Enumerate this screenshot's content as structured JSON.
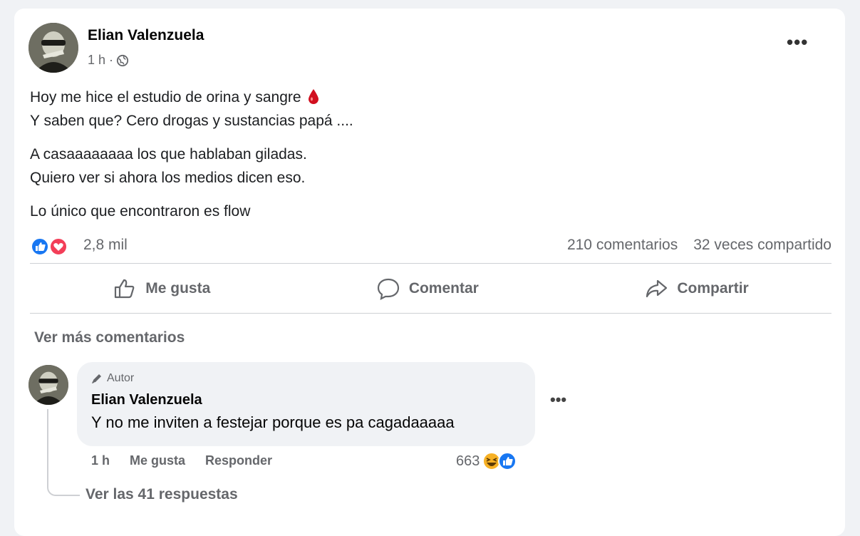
{
  "post": {
    "author": "Elian Valenzuela",
    "time": "1 h ·",
    "more_label": "•••",
    "paragraphs": [
      [
        "Hoy me hice el estudio de orina y sangre",
        "Y saben que? Cero drogas y sustancias papá ...."
      ],
      [
        "A casaaaaaaaa los que hablaban giladas.",
        "Quiero ver si ahora los medios dicen eso."
      ],
      [
        "Lo único que encontraron es flow"
      ]
    ],
    "reaction_count": "2,8 mil",
    "comments_count": "210 comentarios",
    "shares_count": "32 veces compartido",
    "icons": [
      "globe-icon",
      "blood-drop-icon",
      "like-icon",
      "love-icon"
    ],
    "colors": {
      "like_blue": "#1877f2",
      "love_red": "#f33e58",
      "drop_red": "#d10f1f"
    }
  },
  "actions": {
    "like_label": "Me gusta",
    "comment_label": "Comentar",
    "share_label": "Compartir"
  },
  "comments": {
    "see_more_label": "Ver más comentarios",
    "first": {
      "badge": "Autor",
      "author": "Elian Valenzuela",
      "text": "Y no me inviten a festejar porque es pa cagadaaaaa",
      "more_label": "•••",
      "time": "1 h",
      "like_label": "Me gusta",
      "reply_label": "Responder",
      "reaction_count": "663",
      "replies_label": "Ver las 41 respuestas"
    }
  }
}
